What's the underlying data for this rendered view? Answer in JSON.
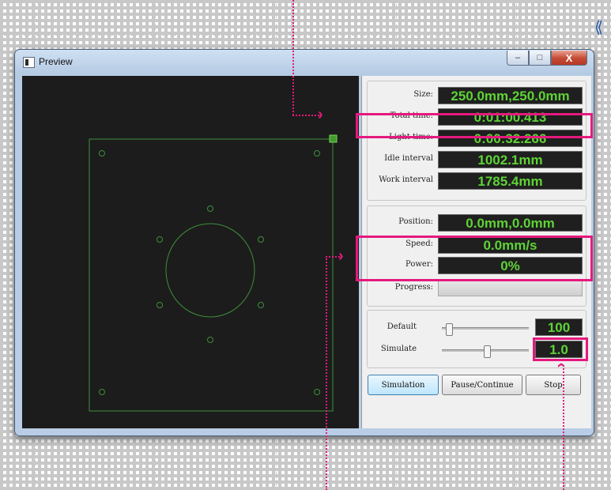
{
  "window": {
    "title": "Preview",
    "buttons": {
      "minimize": "–",
      "maximize": "□",
      "close": "X"
    }
  },
  "info": {
    "size": {
      "label": "Size:",
      "value": "250.0mm,250.0mm"
    },
    "total_time": {
      "label": "Total time:",
      "value": "0:01:00.413"
    },
    "light_time": {
      "label": "Light time:",
      "value": "0:00:32.266"
    },
    "idle_interval": {
      "label": "Idle interval",
      "value": "1002.1mm"
    },
    "work_interval": {
      "label": "Work interval",
      "value": "1785.4mm"
    }
  },
  "status": {
    "position": {
      "label": "Position:",
      "value": "0.0mm,0.0mm"
    },
    "speed": {
      "label": "Speed:",
      "value": "0.0mm/s"
    },
    "power": {
      "label": "Power:",
      "value": "0%"
    },
    "progress": {
      "label": "Progress:",
      "value": 0
    }
  },
  "sliders": {
    "default": {
      "label": "Default",
      "value": "100",
      "level": 0.05
    },
    "simulate": {
      "label": "Simulate",
      "value": "1.0",
      "level": 0.52
    }
  },
  "buttons": {
    "simulation": "Simulation",
    "pause_continue": "Pause/Continue",
    "stop": "Stop"
  },
  "colors": {
    "highlight": "#e6197e",
    "readout_text": "#5ed336",
    "canvas_bg": "#1c1c1c",
    "drawing_line": "#3f8f3a"
  }
}
